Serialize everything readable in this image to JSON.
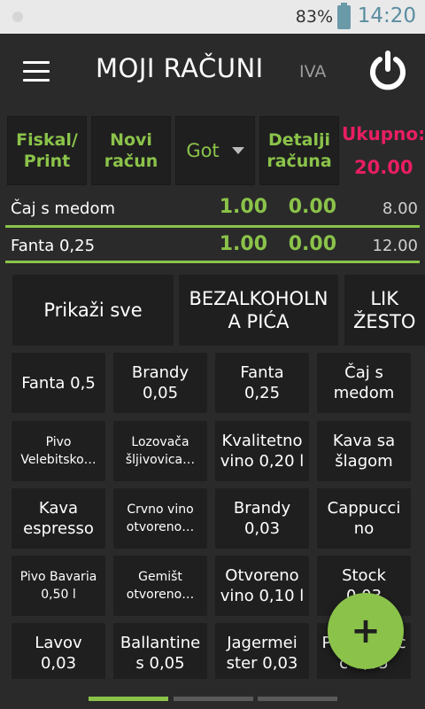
{
  "status_bar": {
    "battery_percent": "83%",
    "time": "14:20"
  },
  "header": {
    "title": "MOJI RAČUNI",
    "iva_label": "IVA"
  },
  "actions": {
    "fiskal_print": [
      "Fiskal/",
      "Print"
    ],
    "novi_racun": [
      "Novi",
      "račun"
    ],
    "payment_selected": "Got",
    "detalji_racuna": [
      "Detalji",
      "računa"
    ],
    "total_label": "Ukupno:",
    "total_value": "20.00"
  },
  "bill_lines": [
    {
      "name": "Čaj s medom",
      "qty": "1.00",
      "discount": "0.00",
      "amount": "8.00"
    },
    {
      "name": "Fanta 0,25",
      "qty": "1.00",
      "discount": "0.00",
      "amount": "12.00"
    }
  ],
  "categories": [
    {
      "label": [
        "Prikaži sve"
      ]
    },
    {
      "label": [
        "BEZALKOHOLN",
        "A PIĆA"
      ]
    },
    {
      "label": [
        "LIK",
        "ŽESTO"
      ]
    }
  ],
  "products": [
    [
      "Fanta 0,5"
    ],
    [
      "Brandy",
      "0,05"
    ],
    [
      "Fanta",
      "0,25"
    ],
    [
      "Čaj s",
      "medom"
    ],
    [
      "Pivo",
      "Velebitsko…"
    ],
    [
      "Lozovača",
      "šljivovica…"
    ],
    [
      "Kvalitetno",
      "vino 0,20 l"
    ],
    [
      "Kava sa",
      "šlagom"
    ],
    [
      "Kava",
      "espresso"
    ],
    [
      "Crvno vino",
      "otvoreno…"
    ],
    [
      "Brandy",
      "0,03"
    ],
    [
      "Cappucci",
      "no"
    ],
    [
      "Pivo Bavaria",
      "0,50 l"
    ],
    [
      "Gemišt",
      "otvoreno…"
    ],
    [
      "Otvoreno",
      "vino 0,10 l"
    ],
    [
      "Stock",
      "0,03"
    ],
    [
      "Lavov",
      "0,03"
    ],
    [
      "Ballantine",
      "s 0,05"
    ],
    [
      "Jagermei",
      "ster 0,03"
    ],
    [
      "Pelinkovac",
      "c 0,05"
    ]
  ],
  "product_styles": [
    "lg",
    "lg",
    "lg",
    "lg",
    "sm",
    "sm",
    "lg",
    "lg",
    "lg",
    "sm",
    "lg",
    "lg",
    "sm",
    "sm",
    "lg",
    "lg",
    "lg",
    "lg",
    "lg",
    "lg"
  ],
  "fab": {
    "icon": "plus-icon",
    "label": "+"
  },
  "pager": {
    "page_count": 3,
    "active_index": 0
  },
  "colors": {
    "accent_green": "#8bc34a",
    "total_pink": "#e91e63",
    "background": "#2a2a2a",
    "tile": "#1f1f1f"
  }
}
